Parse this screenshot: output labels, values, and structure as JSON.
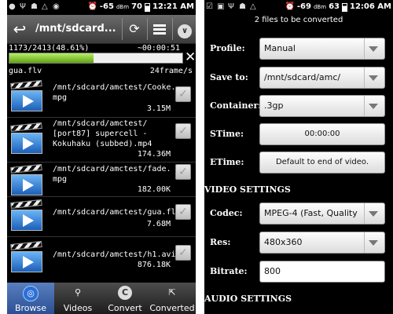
{
  "left": {
    "status": {
      "signal": "-65",
      "signal_unit": "dBm",
      "battery": "70",
      "time": "12:21 AM"
    },
    "title": {
      "path": "/mnt/sdcard..."
    },
    "progress": {
      "count": "1173/2413(48.61%)",
      "eta": "~00:00:51",
      "percent": 48.61,
      "file": "gua.flv",
      "rate": "24frame/s"
    },
    "files": [
      {
        "name": "/mnt/sdcard/amctest/Cooke.\nmpg",
        "size": "3.15M"
      },
      {
        "name": "/mnt/sdcard/amctest/\n[port87] supercell -\nKokuhaku (subbed).mp4",
        "size": "174.36M"
      },
      {
        "name": "/mnt/sdcard/amctest/fade.\nmpg",
        "size": "182.00K"
      },
      {
        "name": "/mnt/sdcard/amctest/gua.flv",
        "size": "7.68M"
      },
      {
        "name": "/mnt/sdcard/amctest/h1.avi",
        "size": "876.18K"
      }
    ],
    "tabs": [
      {
        "label": "Browse",
        "icon": "globe-icon"
      },
      {
        "label": "Videos",
        "icon": "search-icon"
      },
      {
        "label": "Convert",
        "icon": "convert-icon"
      },
      {
        "label": "Converted",
        "icon": "export-icon"
      }
    ]
  },
  "right": {
    "status": {
      "signal": "-69",
      "signal_unit": "dBm",
      "battery": "63",
      "time": "12:06 AM"
    },
    "header": "2  files to be converted",
    "form": {
      "profile_label": "Profile:",
      "profile_value": "Manual",
      "save_label": "Save to:",
      "save_value": "/mnt/sdcard/amc/",
      "container_label": "Container:",
      "container_value": ".3gp",
      "stime_label": "STime:",
      "stime_value": "00:00:00",
      "etime_label": "ETime:",
      "etime_value": "Default to end of video."
    },
    "video_section": "VIDEO SETTINGS",
    "video": {
      "codec_label": "Codec:",
      "codec_value": "MPEG-4 (Fast, Quality",
      "res_label": "Res:",
      "res_value": "480x360",
      "bitrate_label": "Bitrate:",
      "bitrate_value": "800"
    },
    "audio_section": "AUDIO SETTINGS"
  }
}
